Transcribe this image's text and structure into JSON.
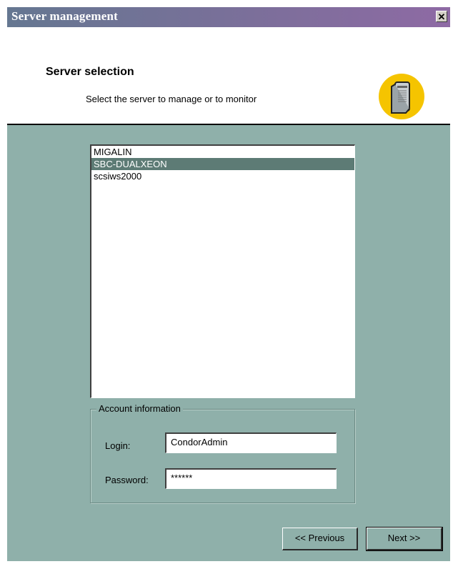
{
  "window": {
    "title": "Server management",
    "close_symbol": "✕"
  },
  "header": {
    "title": "Server selection",
    "subtitle": "Select the server to manage or to monitor",
    "icon": "server-icon"
  },
  "servers": {
    "items": [
      "MIGALIN",
      "SBC-DUALXEON",
      "scsiws2000"
    ],
    "selected": "SBC-DUALXEON"
  },
  "account": {
    "group_label": "Account information",
    "login_label": "Login:",
    "login_value": "CondorAdmin",
    "password_label": "Password:",
    "password_value": "******"
  },
  "buttons": {
    "previous": "<< Previous",
    "next": "Next >>"
  },
  "colors": {
    "dialog_bg": "#8fb0aa",
    "selection": "#5d7b75",
    "icon_circle": "#f5c400"
  }
}
